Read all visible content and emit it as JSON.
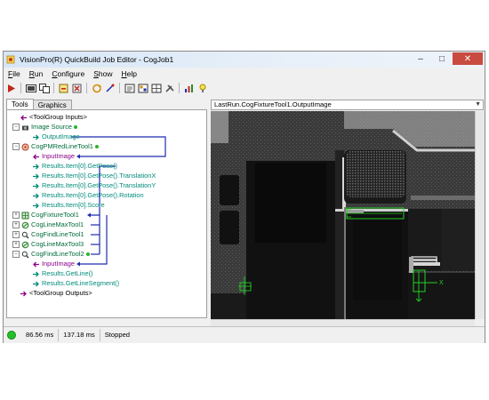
{
  "window": {
    "title": "VisionPro(R) QuickBuild Job Editor - CogJob1"
  },
  "menu": [
    {
      "label": "File",
      "accel": "F",
      "rest": "ile"
    },
    {
      "label": "Run",
      "accel": "R",
      "rest": "un"
    },
    {
      "label": "Configure",
      "accel": "C",
      "rest": "onfigure"
    },
    {
      "label": "Show",
      "accel": "S",
      "rest": "how"
    },
    {
      "label": "Help",
      "accel": "H",
      "rest": "elp"
    }
  ],
  "tabs": [
    "Tools",
    "Graphics"
  ],
  "tree": [
    {
      "label": "<ToolGroup Inputs>",
      "kind": "grp"
    },
    {
      "label": "Image Source",
      "kind": "tool",
      "status": true
    },
    {
      "label": "OutputImage",
      "kind": "term"
    },
    {
      "label": "CogPMRedLineTool1",
      "kind": "tool",
      "status": true
    },
    {
      "label": "InputImage",
      "kind": "inp"
    },
    {
      "label": "Results.Item[0].GetPose()",
      "kind": "term"
    },
    {
      "label": "Results.Item[0].GetPose().TranslationX",
      "kind": "term"
    },
    {
      "label": "Results.Item[0].GetPose().TranslationY",
      "kind": "term"
    },
    {
      "label": "Results.Item[0].GetPose().Rotation",
      "kind": "term"
    },
    {
      "label": "Results.Item[0].Score",
      "kind": "term"
    },
    {
      "label": "CogFixtureTool1",
      "kind": "tool"
    },
    {
      "label": "CogLineMaxTool1",
      "kind": "tool"
    },
    {
      "label": "CogFindLineTool1",
      "kind": "tool"
    },
    {
      "label": "CogLineMaxTool3",
      "kind": "tool"
    },
    {
      "label": "CogFindLineTool2",
      "kind": "tool",
      "status": true
    },
    {
      "label": "InputImage",
      "kind": "inp"
    },
    {
      "label": "Results.GetLine()",
      "kind": "term"
    },
    {
      "label": "Results.GetLineSegment()",
      "kind": "term"
    },
    {
      "label": "<ToolGroup Outputs>",
      "kind": "grp"
    }
  ],
  "viewer": {
    "image_name": "LastRun.CogFixtureTool1.OutputImage",
    "overlay_label": "X"
  },
  "status": {
    "time1": "86.56 ms",
    "time2": "137.18 ms",
    "state": "Stopped"
  },
  "colors": {
    "link_blue": "#1f2ab0",
    "status_green": "#24c02a"
  }
}
